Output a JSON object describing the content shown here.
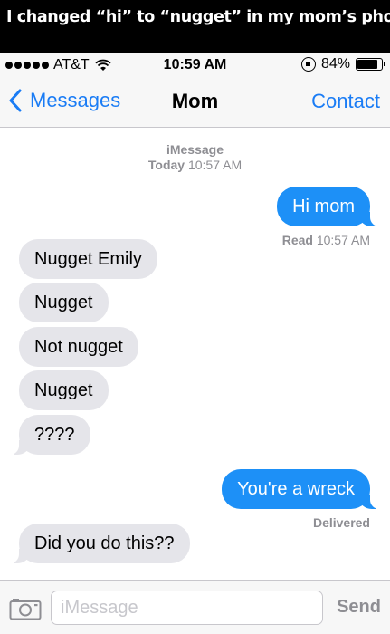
{
  "caption": {
    "text": "I changed “hi” to “nugget” in my mom’s phone..."
  },
  "status_bar": {
    "carrier": "AT&T",
    "time": "10:59 AM",
    "battery_text": "84%",
    "battery_level": 0.84
  },
  "nav": {
    "back_label": "Messages",
    "title": "Mom",
    "contact_label": "Contact"
  },
  "thread": {
    "service": "iMessage",
    "date_day": "Today",
    "date_time": "10:57 AM"
  },
  "messages": [
    {
      "from": "me",
      "text": "Hi mom"
    },
    {
      "from": "mom",
      "text": "Nugget Emily"
    },
    {
      "from": "mom",
      "text": "Nugget"
    },
    {
      "from": "mom",
      "text": "Not nugget"
    },
    {
      "from": "mom",
      "text": "Nugget"
    },
    {
      "from": "mom",
      "text": "????"
    },
    {
      "from": "me",
      "text": "You're a wreck"
    },
    {
      "from": "mom",
      "text": "Did you do this??"
    }
  ],
  "receipts": {
    "read_label": "Read",
    "read_time": "10:57 AM",
    "delivered_label": "Delivered"
  },
  "input_bar": {
    "placeholder": "iMessage",
    "value": "",
    "send_label": "Send"
  },
  "colors": {
    "accent": "#1a7cf5",
    "sent_bubble": "#1d90f7",
    "received_bubble": "#e5e5ea",
    "meta_text": "#8e8e93"
  },
  "icons": [
    "signal-dots-icon",
    "wifi-icon",
    "rotation-lock-icon",
    "battery-icon",
    "chevron-left-icon",
    "camera-icon"
  ]
}
